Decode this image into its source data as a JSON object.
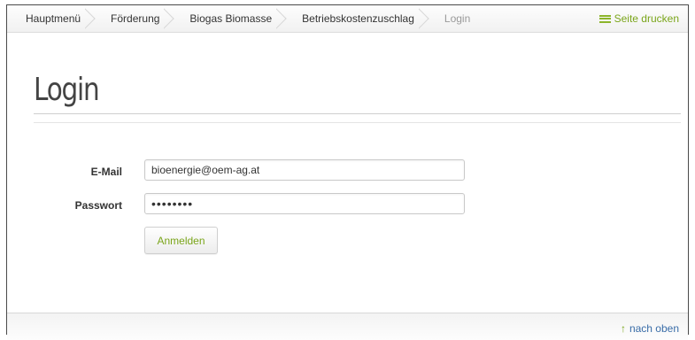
{
  "breadcrumb": {
    "items": [
      {
        "label": "Hauptmenü"
      },
      {
        "label": "Förderung"
      },
      {
        "label": "Biogas Biomasse"
      },
      {
        "label": "Betriebskostenzuschlag"
      },
      {
        "label": "Login"
      }
    ],
    "print_label": "Seite drucken",
    "print_icon": "list-icon"
  },
  "page": {
    "title": "Login"
  },
  "form": {
    "email_label": "E-Mail",
    "email_value": "bioenergie@oem-ag.at",
    "password_label": "Passwort",
    "password_value": "secretpw",
    "submit_label": "Anmelden"
  },
  "footer": {
    "top_link_label": "nach oben",
    "top_link_icon": "arrow-up-icon"
  },
  "colors": {
    "accent_green": "#7aa51a",
    "link_blue": "#3a6da8",
    "title_gray": "#444444"
  }
}
